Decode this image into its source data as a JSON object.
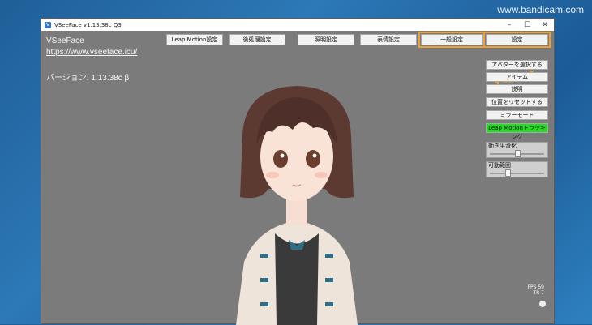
{
  "watermark": "www.bandicam.com",
  "window": {
    "title": "VSeeFace v1.13.38c Q3",
    "icon_text": "V",
    "controls": [
      "–",
      "☐",
      "✕"
    ]
  },
  "info": {
    "app_name": "VSeeFace",
    "url": "https://www.vseeface.icu/",
    "version": "バージョン: 1.13.38c β"
  },
  "top_buttons": {
    "leap_motion": "Leap Motion設定",
    "post_processing": "後処理設定",
    "lighting": "照明設定",
    "expression": "表情設定",
    "general": "一般設定",
    "settings": "設定"
  },
  "right_panel": {
    "select_avatar": "アバターを選択する",
    "items": "アイテム",
    "description": "説明",
    "reset_position": "位置をリセットする",
    "mirror_mode": "ミラーモード",
    "leap_tracking": "Leap Motionトラッキング"
  },
  "sliders": {
    "smoothing": {
      "label": "動き平滑化",
      "value": 0.5
    },
    "range": {
      "label": "可動範囲",
      "value": 0.3
    }
  },
  "fps": {
    "line1": "FPS 59",
    "line2": "TR  7"
  },
  "colors": {
    "highlight": "#f0a030",
    "tracking_on": "#22dd22",
    "viewport": "#7b7b7b"
  }
}
